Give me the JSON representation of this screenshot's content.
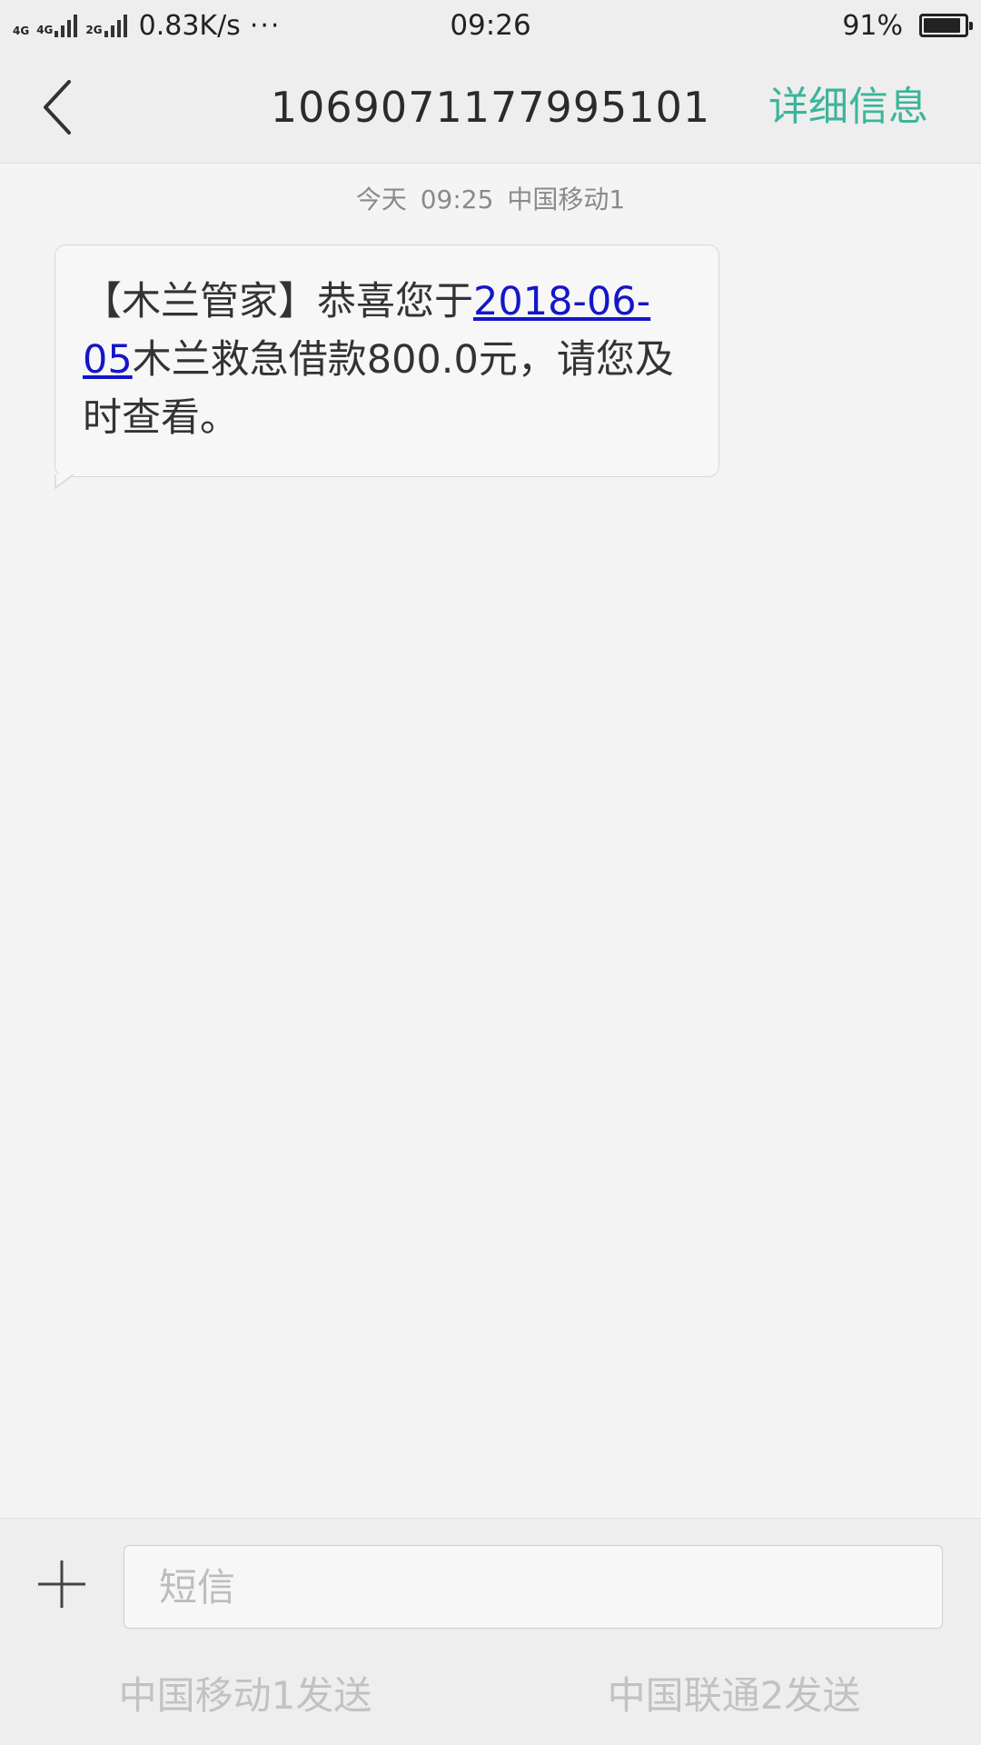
{
  "status_bar": {
    "net1_label": "4G",
    "net2_label": "4G",
    "net3_label": "2G",
    "speed": "0.83K/s",
    "more": "···",
    "time": "09:26",
    "battery_text": "91%",
    "battery_level": 0.91
  },
  "header": {
    "title": "1069071177995101",
    "details_label": "详细信息",
    "back_icon": "chevron-left-icon"
  },
  "conversation": {
    "timestamp": "今天 09:25 中国移动1",
    "message": {
      "prefix": "【木兰管家】恭喜您于",
      "link": "2018-06-05",
      "suffix": "木兰救急借款800.0元，请您及时查看。"
    }
  },
  "composer": {
    "add_icon": "plus-icon",
    "input_placeholder": "短信",
    "input_value": "",
    "send_sim1_label": "中国移动1发送",
    "send_sim2_label": "中国联通2发送"
  },
  "colors": {
    "accent": "#3bb59b",
    "link": "#1515c8",
    "background": "#f4f4f4"
  }
}
